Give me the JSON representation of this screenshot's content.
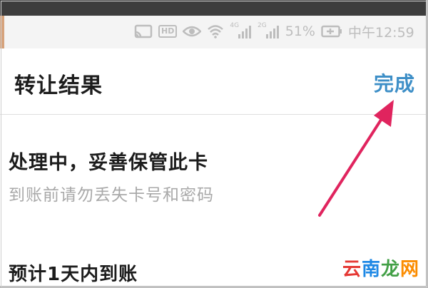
{
  "status_bar": {
    "hd": "HD",
    "net1": "4G",
    "net2": "2G",
    "battery": "51%",
    "time": "中午12:59"
  },
  "header": {
    "title": "转让结果",
    "done_label": "完成"
  },
  "content": {
    "status_title": "处理中，妥善保管此卡",
    "status_subtitle": "到账前请勿丢失卡号和密码",
    "eta": "预计1天内到账"
  },
  "watermark": {
    "part1": "云",
    "part2": "南",
    "part3": "龙",
    "part4": "网"
  },
  "colors": {
    "accent": "#3e8fc7",
    "arrow": "#e0245e",
    "status_icon": "#bdbdbd"
  }
}
